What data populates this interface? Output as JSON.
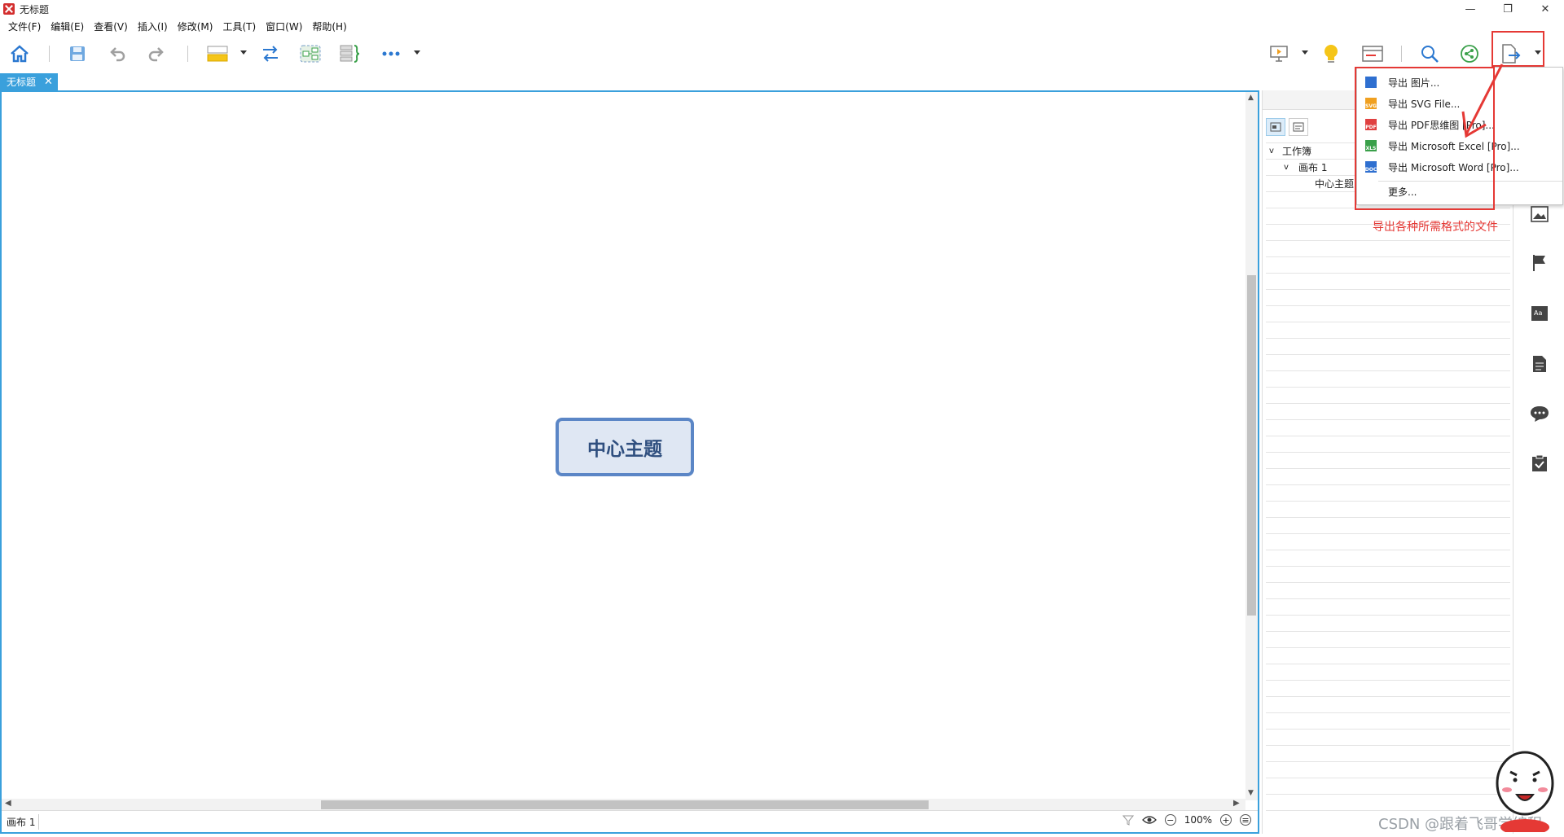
{
  "window": {
    "title": "无标题",
    "controls": [
      "—",
      "❐",
      "✕"
    ]
  },
  "menubar": {
    "items": [
      "文件(F)",
      "编辑(E)",
      "查看(V)",
      "插入(I)",
      "修改(M)",
      "工具(T)",
      "窗口(W)",
      "帮助(H)"
    ]
  },
  "toolbar": {
    "icons": [
      "home-icon",
      "save-icon",
      "undo-icon",
      "redo-icon",
      "topic-style-icon",
      "relationship-icon",
      "boundary-icon",
      "summary-icon",
      "more-icon",
      "presentation-icon",
      "idea-icon",
      "outline-view-icon",
      "search-icon",
      "share-icon",
      "export-icon"
    ]
  },
  "document_tab": {
    "label": "无标题",
    "close": "✕"
  },
  "canvas": {
    "central_topic": "中心主题",
    "sheet_tab": "画布 1",
    "zoom": "100%"
  },
  "side_panel": {
    "tree": [
      {
        "label": "工作簿",
        "expander": "v"
      },
      {
        "label": "画布 1",
        "expander": "v"
      },
      {
        "label": "中心主题",
        "expander": ""
      }
    ]
  },
  "export_menu": {
    "items": [
      {
        "label": "导出 图片...",
        "icon_label": "",
        "icon_color": "#2e6fd0"
      },
      {
        "label": "导出 SVG File...",
        "icon_label": "SVG",
        "icon_color": "#f0a020"
      },
      {
        "label": "导出 PDF思维图 [Pro]...",
        "icon_label": "PDF",
        "icon_color": "#e04040"
      },
      {
        "label": "导出 Microsoft Excel [Pro]...",
        "icon_label": "XLS",
        "icon_color": "#3aa04a"
      },
      {
        "label": "导出 Microsoft Word [Pro]...",
        "icon_label": "DOC",
        "icon_color": "#2e6fd0"
      },
      {
        "label": "更多...",
        "icon_label": "",
        "icon_color": ""
      }
    ]
  },
  "annotation": {
    "note": "导出各种所需格式的文件",
    "color": "#e53935"
  },
  "watermark": "CSDN @跟着飞哥学编程"
}
